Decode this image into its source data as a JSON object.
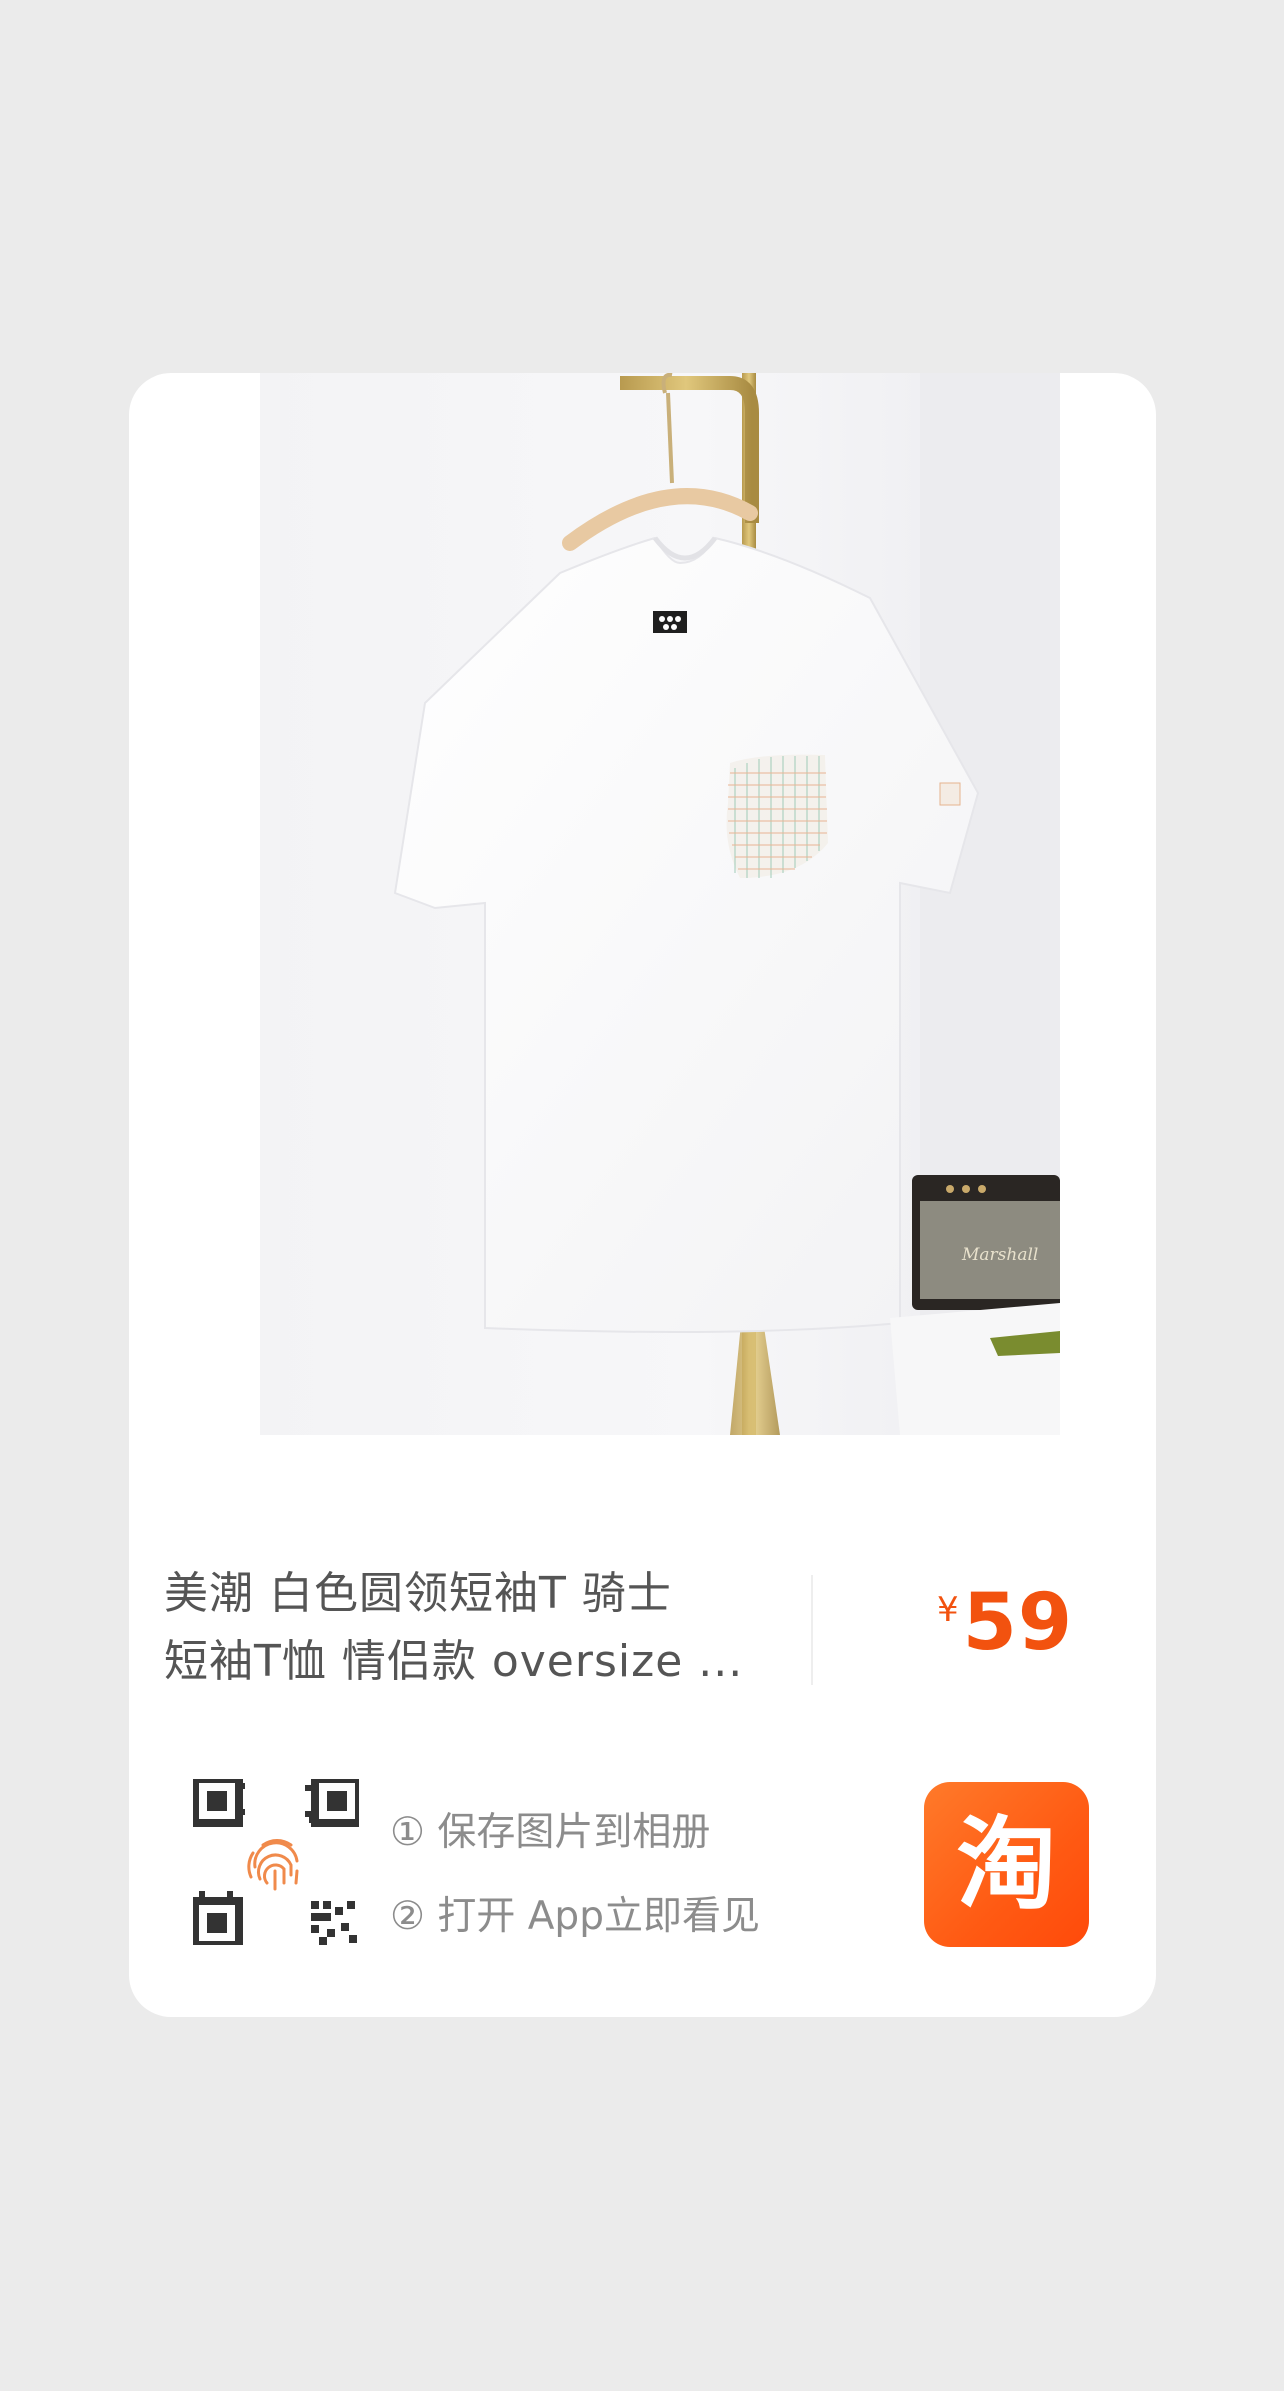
{
  "product": {
    "image_icon": "white-tshirt-photo",
    "title_line1": "美潮 白色圆领短袖T 骑士",
    "title_line2": "短袖T恤 情侣款 oversize ...",
    "price_currency": "¥",
    "price_value": "59"
  },
  "share": {
    "qr_icon": "qr-code-fingerprint-icon",
    "step1": "① 保存图片到相册",
    "step2": "② 打开 App立即看见"
  },
  "app": {
    "logo_text": "淘",
    "logo_icon": "taobao-app-icon"
  },
  "colors": {
    "background": "#ebebeb",
    "card": "#ffffff",
    "price": "#f2520f",
    "brand": "#ff5a13"
  }
}
